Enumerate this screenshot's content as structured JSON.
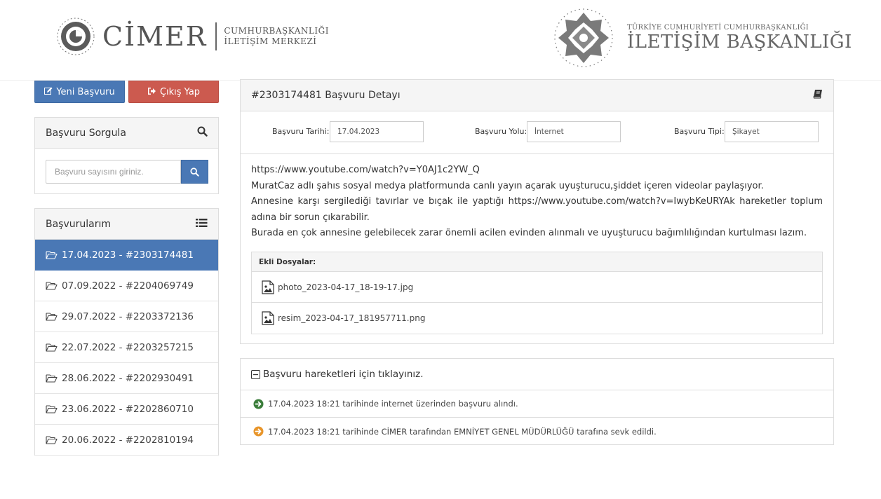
{
  "header": {
    "cimer_word": "CİMER",
    "cimer_sub_line1": "CUMHURBAŞKANLIĞI",
    "cimer_sub_line2": "İLETİŞİM MERKEZİ",
    "ib_top": "TÜRKİYE CUMHURİYETİ CUMHURBAŞKANLIĞI",
    "ib_main": "İLETİŞİM BAŞKANLIĞI"
  },
  "sidebar": {
    "new_button": "Yeni Başvuru",
    "exit_button": "Çıkış Yap",
    "query": {
      "title": "Başvuru Sorgula",
      "placeholder": "Başvuru sayısını giriniz."
    },
    "applications": {
      "title": "Başvurularım",
      "items": [
        {
          "label": "17.04.2023 - #2303174481",
          "active": true
        },
        {
          "label": "07.09.2022 - #2204069749",
          "active": false
        },
        {
          "label": "29.07.2022 - #2203372136",
          "active": false
        },
        {
          "label": "22.07.2022 - #2203257215",
          "active": false
        },
        {
          "label": "28.06.2022 - #2202930491",
          "active": false
        },
        {
          "label": "23.06.2022 - #2202860710",
          "active": false
        },
        {
          "label": "20.06.2022 - #2202810194",
          "active": false
        }
      ]
    }
  },
  "detail": {
    "title": "#2303174481 Başvuru Detayı",
    "date_label": "Başvuru Tarihi:",
    "date_value": "17.04.2023",
    "channel_label": "Başvuru Yolu:",
    "channel_value": "İnternet",
    "type_label": "Başvuru Tipi:",
    "type_value": "Şikayet",
    "body_lines": [
      "https://www.youtube.com/watch?v=Y0AJ1c2YW_Q",
      "MuratCaz adlı şahıs sosyal medya platformunda canlı yayın açarak uyuşturucu,şiddet içeren videolar paylaşıyor.",
      "Annesine karşı sergilediği tavırlar ve bıçak ile yaptığı https://www.youtube.com/watch?v=IwybKeURYAk hareketler toplum adına bir sorun çıkarabilir.",
      "Burada en çok annesine gelebilecek zarar önemli acilen evinden alınmalı ve uyuşturucu bağımlılığından kurtulması lazım."
    ],
    "files_label": "Ekli Dosyalar:",
    "files": [
      "photo_2023-04-17_18-19-17.jpg",
      "resim_2023-04-17_181957711.png"
    ]
  },
  "history": {
    "title": "Başvuru hareketleri için tıklayınız.",
    "events": [
      {
        "text": "17.04.2023 18:21 tarihinde internet üzerinden başvuru alındı.",
        "color": "#3a7d3a"
      },
      {
        "text": "17.04.2023 18:21 tarihinde CİMER tarafından EMNİYET GENEL MÜDÜRLÜĞÜ tarafına sevk edildi.",
        "color": "#e8952a"
      }
    ]
  },
  "colors": {
    "primary": "#4a78b5",
    "danger": "#cc5a4f"
  }
}
